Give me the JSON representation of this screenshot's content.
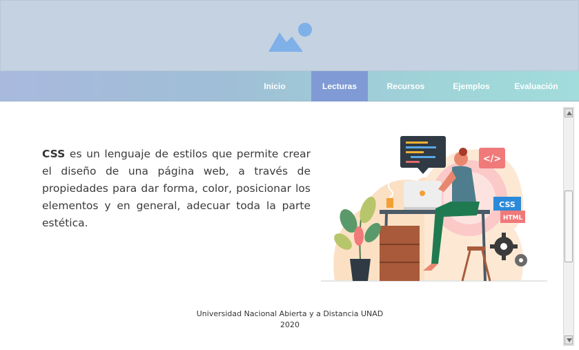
{
  "header": {
    "banner_icon": "image-placeholder-icon"
  },
  "nav": {
    "items": [
      {
        "label": "Inicio",
        "active": false
      },
      {
        "label": "Lecturas",
        "active": true
      },
      {
        "label": "Recursos",
        "active": false
      },
      {
        "label": "Ejemplos",
        "active": false
      },
      {
        "label": "Evaluación",
        "active": false
      }
    ]
  },
  "main": {
    "intro_strong": "CSS",
    "intro_rest": " es un lenguaje de estilos que permite crear el diseño de una página web, a través de propiedades para dar forma, color, posicionar los elementos y en general, adecuar toda la parte estética.",
    "illustration": {
      "code_badge": "</>",
      "css_badge": "CSS",
      "html_badge": "HTML",
      "icon": "developer-illustration"
    }
  },
  "footer": {
    "line1": "Universidad Nacional Abierta y a Distancia UNAD",
    "line2": "2020"
  },
  "colors": {
    "header_bg": "#c5d2e2",
    "nav_active": "#7f9ad4",
    "nav_text": "#ffffff",
    "accent_pink": "#f0797a"
  }
}
